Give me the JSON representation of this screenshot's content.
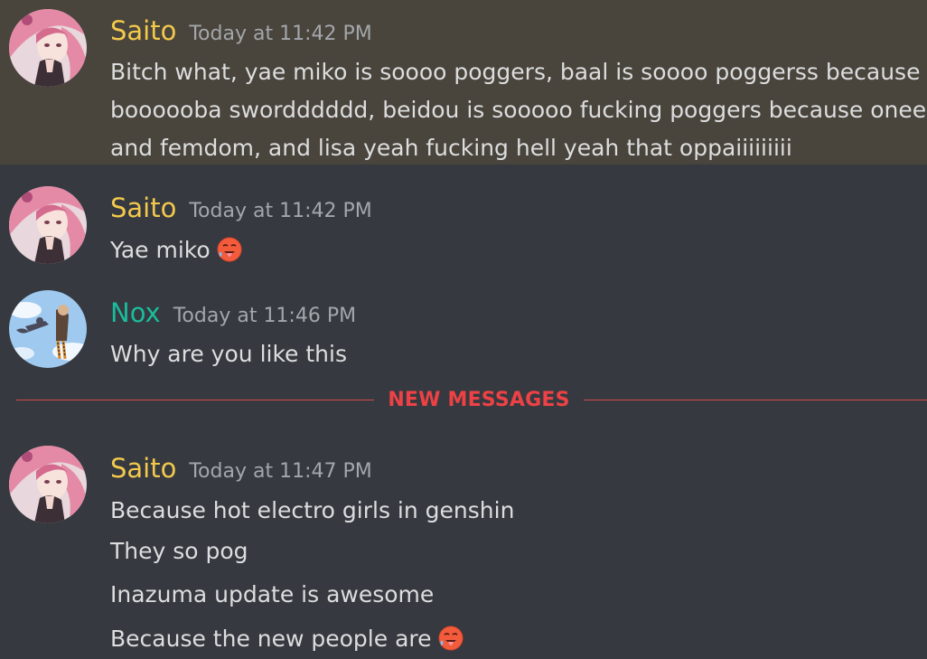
{
  "colors": {
    "saito": "#f2c94c",
    "nox": "#1abc9c",
    "timestamp": "#a3a6aa",
    "text": "#dcddde",
    "new_messages": "#ed4245"
  },
  "messages": [
    {
      "author": "Saito",
      "timestamp": "Today at 11:42 PM",
      "avatar": "saito-avatar",
      "highlighted": true,
      "lines": [
        "Bitch what, yae miko is soooo poggers, baal is soooo poggerss because",
        "boooooba swordddddd, beidou is sooooo fucking poggers because onee san",
        "and femdom, and lisa yeah fucking hell yeah that oppaiiiiiiiii"
      ]
    },
    {
      "author": "Saito",
      "timestamp": "Today at 11:42 PM",
      "avatar": "saito-avatar",
      "lines": [
        "Yae miko"
      ],
      "emoji": "hot-face-emoji"
    },
    {
      "author": "Nox",
      "timestamp": "Today at 11:46 PM",
      "avatar": "nox-avatar",
      "lines": [
        "Why are you like this"
      ]
    },
    {
      "author": "Saito",
      "timestamp": "Today at 11:47 PM",
      "avatar": "saito-avatar",
      "lines": [
        "Because hot electro girls in genshin",
        "They so pog",
        "Inazuma update is awesome",
        "Because the new people are"
      ],
      "emoji": "hot-face-emoji"
    }
  ],
  "divider": {
    "label": "NEW MESSAGES"
  }
}
